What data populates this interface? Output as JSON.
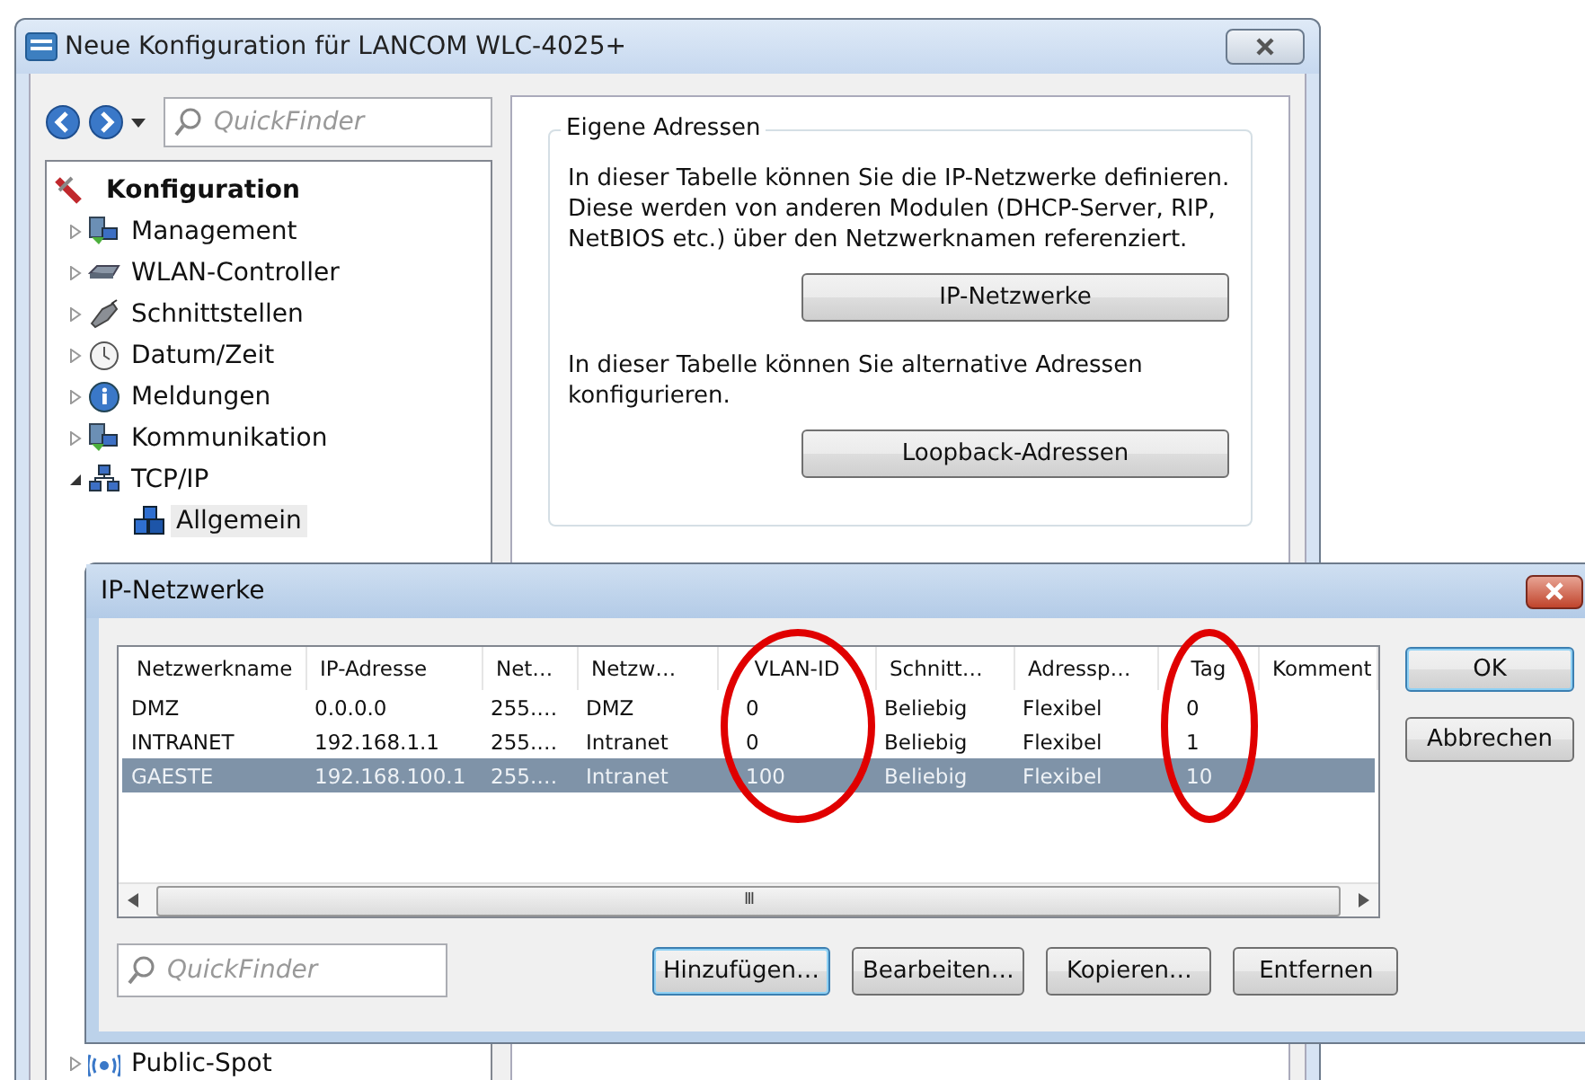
{
  "window": {
    "title": "Neue Konfiguration für LANCOM WLC-4025+"
  },
  "nav": {
    "search": {
      "placeholder": "QuickFinder"
    }
  },
  "tree": {
    "root": "Konfiguration",
    "items": [
      {
        "label": "Management",
        "kind": "computers",
        "expanded": false,
        "selected": false
      },
      {
        "label": "WLAN-Controller",
        "kind": "device",
        "expanded": false,
        "selected": false
      },
      {
        "label": "Schnittstellen",
        "kind": "plug",
        "expanded": false,
        "selected": false
      },
      {
        "label": "Datum/Zeit",
        "kind": "clock",
        "expanded": false,
        "selected": false
      },
      {
        "label": "Meldungen",
        "kind": "info",
        "expanded": false,
        "selected": false
      },
      {
        "label": "Kommunikation",
        "kind": "computers",
        "expanded": false,
        "selected": false
      },
      {
        "label": "TCP/IP",
        "kind": "network",
        "expanded": true,
        "selected": false,
        "children": [
          {
            "label": "Allgemein",
            "kind": "cubes",
            "selected": true
          }
        ]
      }
    ],
    "bottom_item": {
      "label": "Public-Spot",
      "kind": "wireless",
      "expanded": false
    }
  },
  "group": {
    "title": "Eigene Adressen",
    "sections": [
      {
        "text": "In dieser Tabelle können Sie die IP-Netzwerke definieren. Diese werden von anderen Modulen (DHCP-Server, RIP, NetBIOS etc.) über den Netzwerknamen referenziert.",
        "button": "IP-Netzwerke"
      },
      {
        "text": "In dieser Tabelle können Sie alternative Adressen konfigurieren.",
        "button": "Loopback-Adressen"
      }
    ]
  },
  "dialog": {
    "title": "IP-Netzwerke",
    "list": {
      "columns": [
        {
          "label": "Netzwerkname",
          "circled": false
        },
        {
          "label": "IP-Adresse",
          "circled": false
        },
        {
          "label": "Net…",
          "circled": false
        },
        {
          "label": "Netzw…",
          "circled": false
        },
        {
          "label": "VLAN-ID",
          "circled": true
        },
        {
          "label": "Schnitt…",
          "circled": false
        },
        {
          "label": "Adressp…",
          "circled": false
        },
        {
          "label": "Tag",
          "circled": true
        },
        {
          "label": "Komment",
          "circled": false
        }
      ],
      "rows": [
        {
          "cells": [
            "DMZ",
            "0.0.0.0",
            "255.…",
            "DMZ",
            "0",
            "Beliebig",
            "Flexibel",
            "0"
          ],
          "selected": false
        },
        {
          "cells": [
            "INTRANET",
            "192.168.1.1",
            "255.…",
            "Intranet",
            "0",
            "Beliebig",
            "Flexibel",
            "1"
          ],
          "selected": false
        },
        {
          "cells": [
            "GAESTE",
            "192.168.100.1",
            "255.…",
            "Intranet",
            "100",
            "Beliebig",
            "Flexibel",
            "10"
          ],
          "selected": true
        }
      ],
      "scroll_grip": "III"
    },
    "side_buttons": [
      {
        "label": "OK",
        "default": true
      },
      {
        "label": "Abbrechen",
        "default": false
      }
    ],
    "search": {
      "placeholder": "QuickFinder"
    },
    "bottom_buttons": [
      {
        "label": "Hinzufügen…",
        "default": true
      },
      {
        "label": "Bearbeiten…",
        "default": false
      },
      {
        "label": "Kopieren…",
        "default": false
      },
      {
        "label": "Entfernen",
        "default": false
      }
    ]
  }
}
